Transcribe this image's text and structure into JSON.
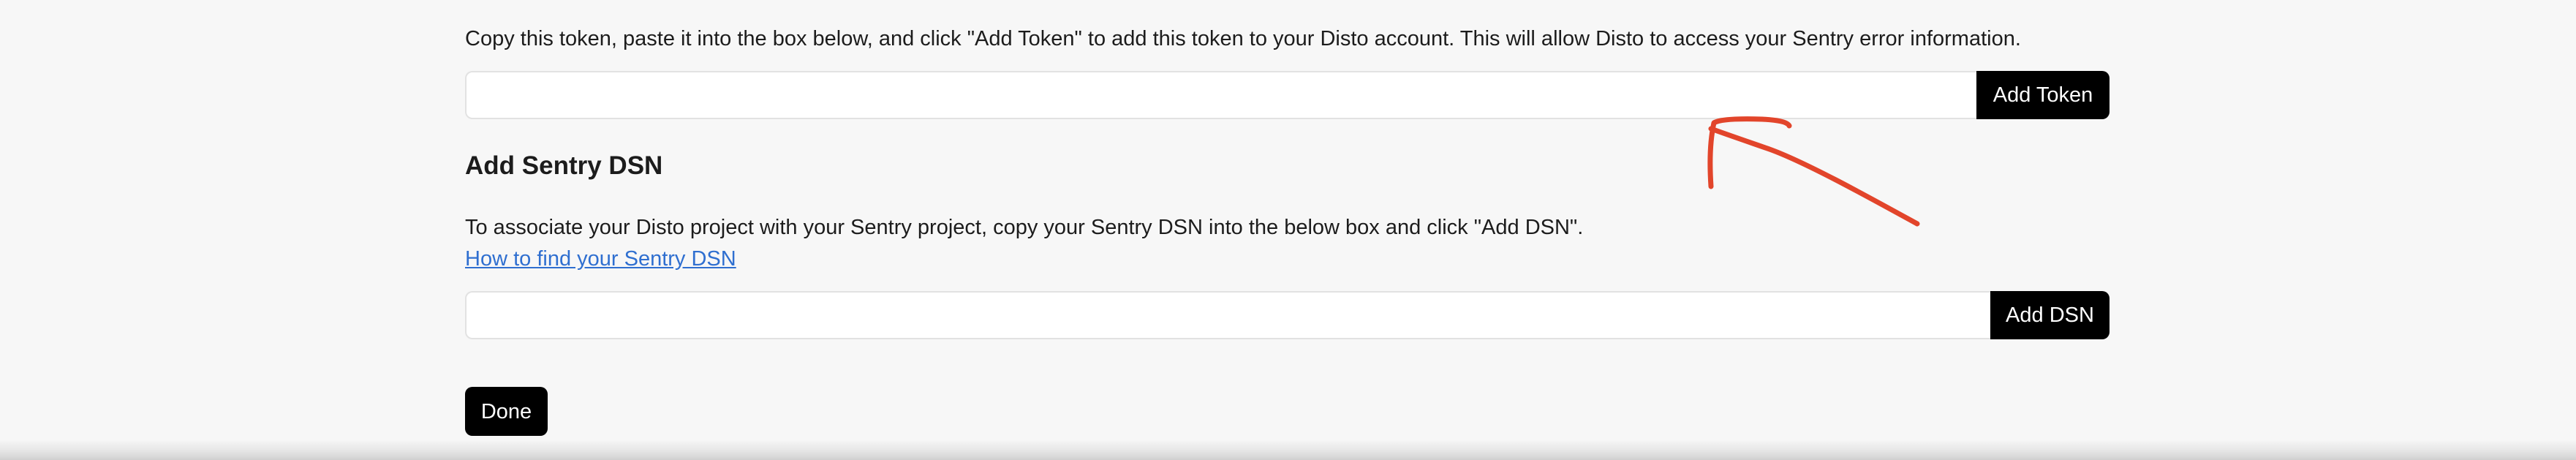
{
  "token_section": {
    "instructions": "Copy this token, paste it into the box below, and click \"Add Token\" to add this token to your Disto account. This will allow Disto to access your Sentry error information.",
    "input_value": "",
    "input_placeholder": "",
    "add_button_label": "Add Token"
  },
  "dsn_section": {
    "heading": "Add Sentry DSN",
    "instructions": "To associate your Disto project with your Sentry project, copy your Sentry DSN into the below box and click \"Add DSN\".",
    "help_link": "How to find your Sentry DSN",
    "input_value": "",
    "input_placeholder": "",
    "add_button_label": "Add DSN"
  },
  "done_button_label": "Done",
  "annotation": {
    "icon": "hand-drawn-arrow-icon",
    "color": "#e2452b"
  },
  "colors": {
    "background": "#f7f7f7",
    "button": "#000000",
    "button_text": "#ffffff",
    "link": "#2f6fd0"
  }
}
